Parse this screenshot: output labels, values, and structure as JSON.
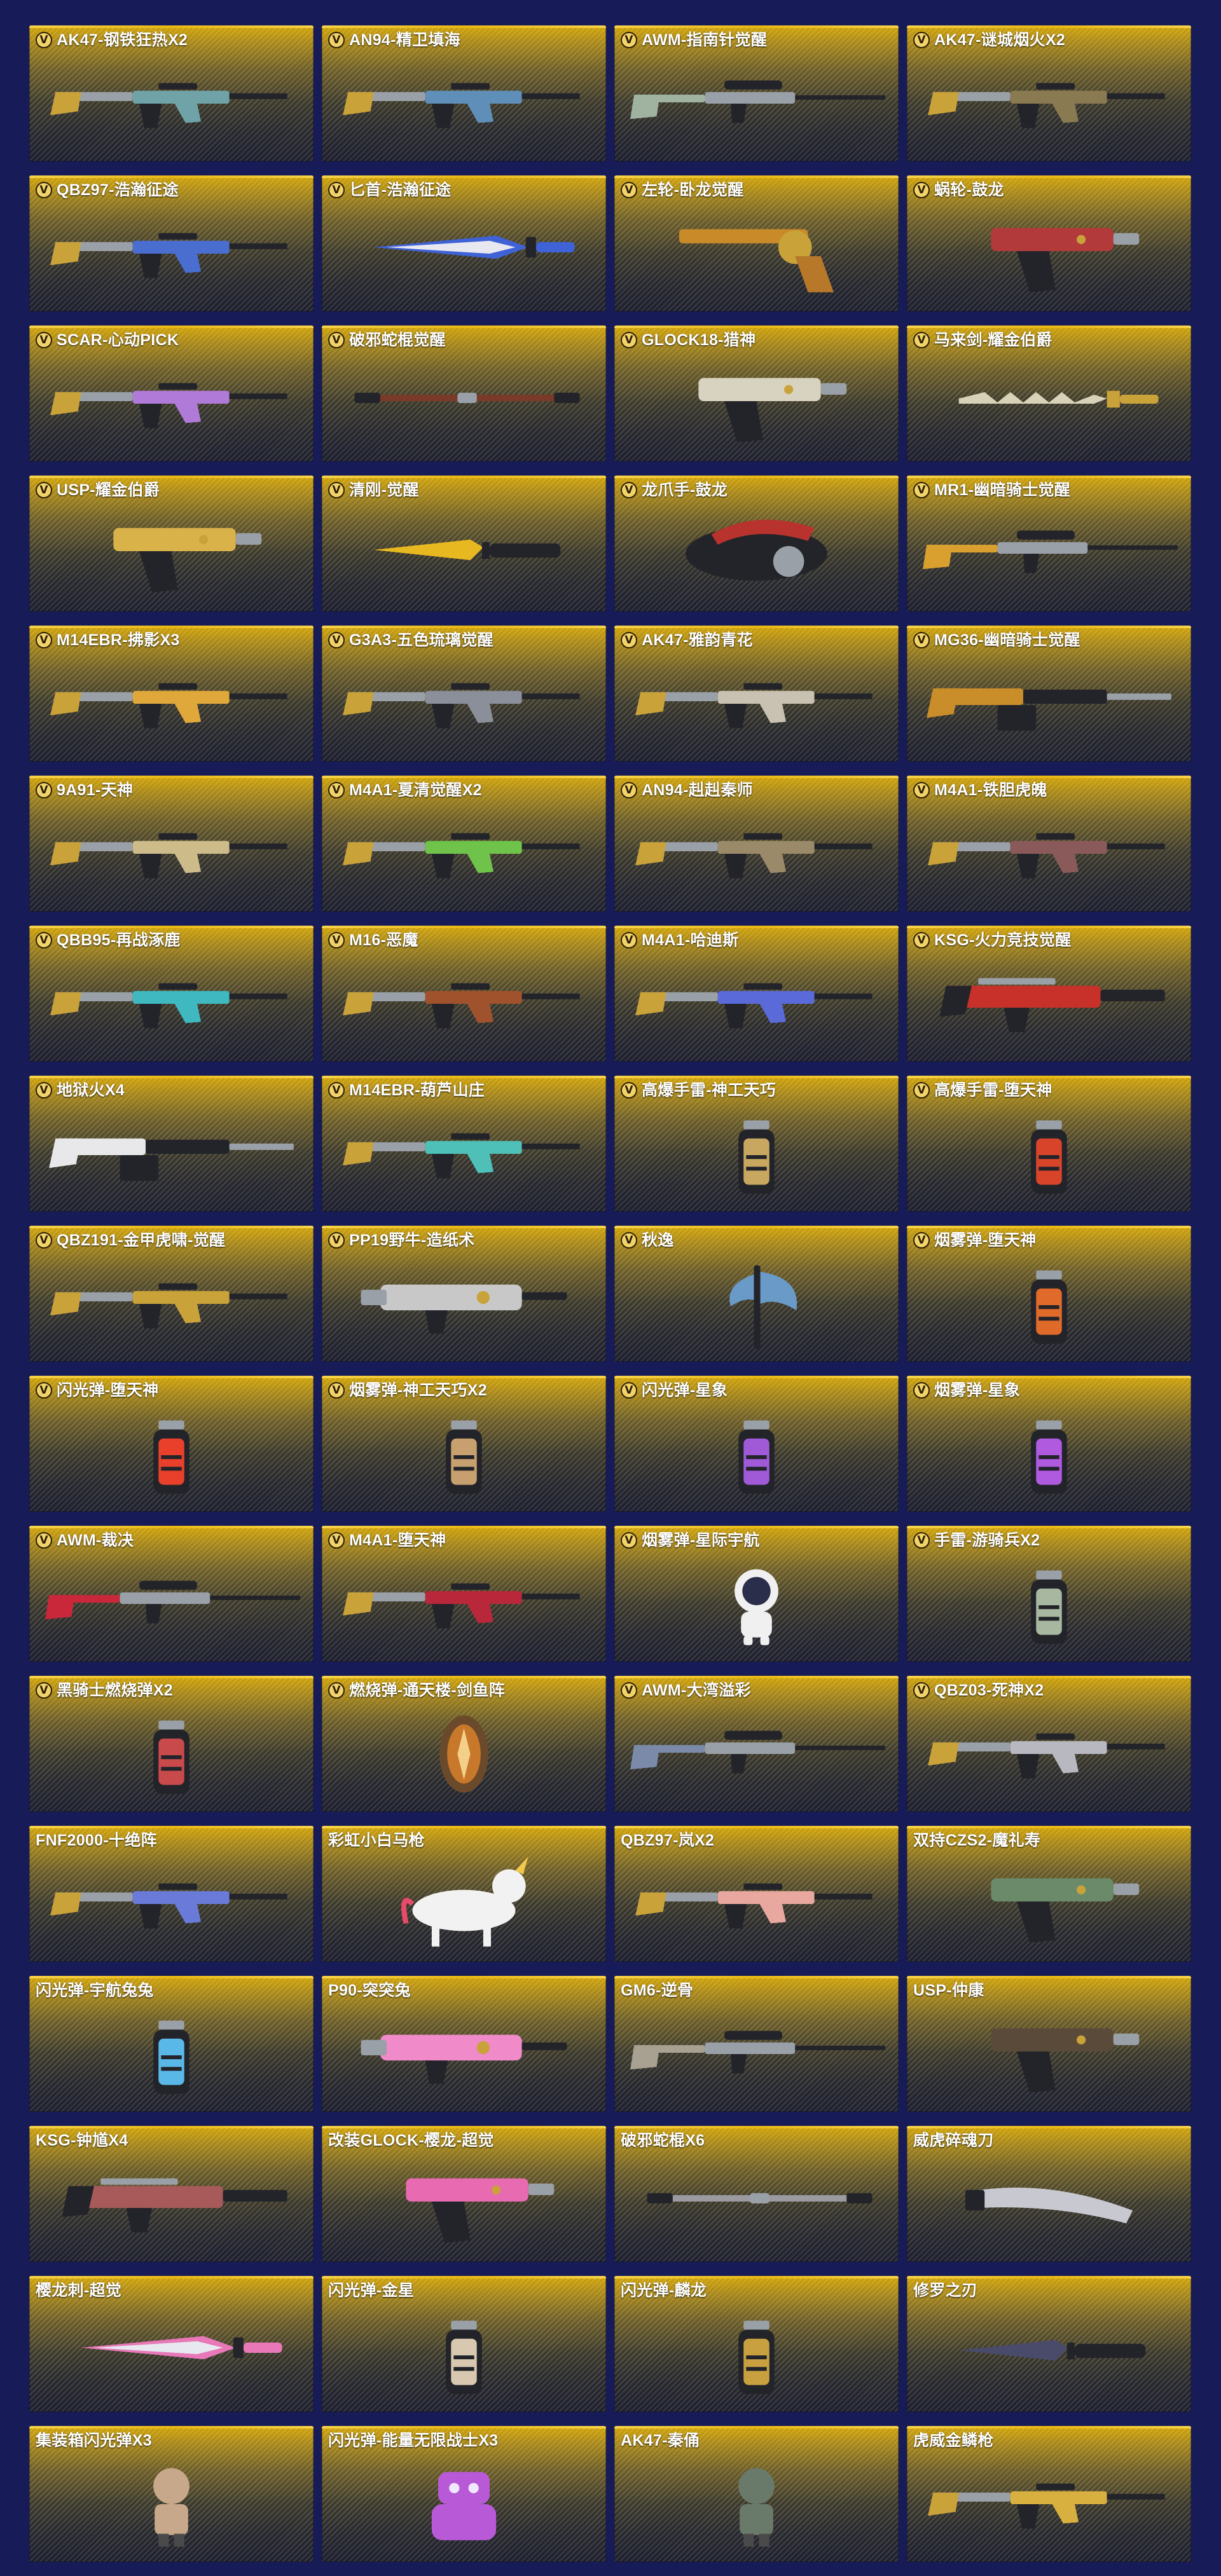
{
  "items": [
    {
      "name": "AK47-钢铁狂热X2",
      "vip": true,
      "icon": "rifle-icon",
      "accent": "#6fa3a8"
    },
    {
      "name": "AN94-精卫填海",
      "vip": true,
      "icon": "rifle-icon",
      "accent": "#5f8fb8"
    },
    {
      "name": "AWM-指南针觉醒",
      "vip": true,
      "icon": "sniper-rifle-icon",
      "accent": "#9fb3a0"
    },
    {
      "name": "AK47-谜城烟火X2",
      "vip": true,
      "icon": "rifle-icon",
      "accent": "#8a7a52"
    },
    {
      "name": "QBZ97-浩瀚征途",
      "vip": true,
      "icon": "rifle-icon",
      "accent": "#4a6ed0"
    },
    {
      "name": "匕首-浩瀚征途",
      "vip": true,
      "icon": "dagger-icon",
      "accent": "#3f62d6"
    },
    {
      "name": "左轮-卧龙觉醒",
      "vip": true,
      "icon": "revolver-icon",
      "accent": "#c98b2a"
    },
    {
      "name": "蜗轮-鼓龙",
      "vip": true,
      "icon": "pistol-icon",
      "accent": "#b33a3a"
    },
    {
      "name": "SCAR-心动PICK",
      "vip": true,
      "icon": "rifle-icon",
      "accent": "#b07ad8"
    },
    {
      "name": "破邪蛇棍觉醒",
      "vip": true,
      "icon": "staff-icon",
      "accent": "#7a3a2a"
    },
    {
      "name": "GLOCK18-猎神",
      "vip": true,
      "icon": "pistol-icon",
      "accent": "#d8d2c0"
    },
    {
      "name": "马来剑-耀金伯爵",
      "vip": true,
      "icon": "kris-sword-icon",
      "accent": "#d8d2b8"
    },
    {
      "name": "USP-耀金伯爵",
      "vip": true,
      "icon": "pistol-icon",
      "accent": "#d9b24a"
    },
    {
      "name": "清刚-觉醒",
      "vip": true,
      "icon": "knife-icon",
      "accent": "#e8b820"
    },
    {
      "name": "龙爪手-鼓龙",
      "vip": true,
      "icon": "claw-weapon-icon",
      "accent": "#b8322e"
    },
    {
      "name": "MR1-幽暗骑士觉醒",
      "vip": true,
      "icon": "sniper-rifle-icon",
      "accent": "#d9a030"
    },
    {
      "name": "M14EBR-拂影X3",
      "vip": true,
      "icon": "rifle-icon",
      "accent": "#e0a83a"
    },
    {
      "name": "G3A3-五色琉璃觉醒",
      "vip": true,
      "icon": "rifle-icon",
      "accent": "#8a8f9a"
    },
    {
      "name": "AK47-雅韵青花",
      "vip": true,
      "icon": "rifle-icon",
      "accent": "#c9c2b2"
    },
    {
      "name": "MG36-幽暗骑士觉醒",
      "vip": true,
      "icon": "machine-gun-icon",
      "accent": "#c98d2a"
    },
    {
      "name": "9A91-天神",
      "vip": true,
      "icon": "rifle-icon",
      "accent": "#cdbb8a"
    },
    {
      "name": "M4A1-夏清觉醒X2",
      "vip": true,
      "icon": "rifle-icon",
      "accent": "#6fc24a"
    },
    {
      "name": "AN94-赳赳秦师",
      "vip": true,
      "icon": "rifle-icon",
      "accent": "#9a8a6a"
    },
    {
      "name": "M4A1-铁胆虎魄",
      "vip": true,
      "icon": "rifle-icon",
      "accent": "#8a5a5a"
    },
    {
      "name": "QBB95-再战涿鹿",
      "vip": true,
      "icon": "rifle-icon",
      "accent": "#3fb8c0"
    },
    {
      "name": "M16-恶魔",
      "vip": true,
      "icon": "rifle-icon",
      "accent": "#a0522d"
    },
    {
      "name": "M4A1-哈迪斯",
      "vip": true,
      "icon": "rifle-icon",
      "accent": "#5a6ad8"
    },
    {
      "name": "KSG-火力竞技觉醒",
      "vip": true,
      "icon": "shotgun-icon",
      "accent": "#c8302a"
    },
    {
      "name": "地狱火X4",
      "vip": true,
      "icon": "machine-gun-icon",
      "accent": "#e8e8ea"
    },
    {
      "name": "M14EBR-葫芦山庄",
      "vip": true,
      "icon": "rifle-icon",
      "accent": "#4ec0b8"
    },
    {
      "name": "高爆手雷-神工天巧",
      "vip": true,
      "icon": "grenade-icon",
      "accent": "#c8a860"
    },
    {
      "name": "高爆手雷-堕天神",
      "vip": true,
      "icon": "grenade-icon",
      "accent": "#d8442a"
    },
    {
      "name": "QBZ191-金甲虎啸-觉醒",
      "vip": true,
      "icon": "rifle-icon",
      "accent": "#c9a23a"
    },
    {
      "name": "PP19野牛-造纸术",
      "vip": true,
      "icon": "smg-icon",
      "accent": "#c8c8c8"
    },
    {
      "name": "秋逸",
      "vip": true,
      "icon": "axe-icon",
      "accent": "#6a9ac8"
    },
    {
      "name": "烟雾弹-堕天神",
      "vip": true,
      "icon": "grenade-icon",
      "accent": "#e06a2a"
    },
    {
      "name": "闪光弹-堕天神",
      "vip": true,
      "icon": "grenade-icon",
      "accent": "#e8402a"
    },
    {
      "name": "烟雾弹-神工天巧X2",
      "vip": true,
      "icon": "grenade-icon",
      "accent": "#c8a070"
    },
    {
      "name": "闪光弹-星象",
      "vip": true,
      "icon": "grenade-icon",
      "accent": "#a05ad8"
    },
    {
      "name": "烟雾弹-星象",
      "vip": true,
      "icon": "grenade-icon",
      "accent": "#b05ae0"
    },
    {
      "name": "AWM-裁决",
      "vip": true,
      "icon": "sniper-rifle-icon",
      "accent": "#c8283a"
    },
    {
      "name": "M4A1-堕天神",
      "vip": true,
      "icon": "rifle-icon",
      "accent": "#b8283a"
    },
    {
      "name": "烟雾弹-星际宇航",
      "vip": true,
      "icon": "astronaut-icon",
      "accent": "#f0f0f0"
    },
    {
      "name": "手雷-游骑兵X2",
      "vip": true,
      "icon": "grenade-icon",
      "accent": "#a8b8a0"
    },
    {
      "name": "黑骑士燃烧弹X2",
      "vip": true,
      "icon": "grenade-icon",
      "accent": "#c84a4a"
    },
    {
      "name": "燃烧弹-通天楼-剑鱼阵",
      "vip": true,
      "icon": "emblem-icon",
      "accent": "#c8782a"
    },
    {
      "name": "AWM-大湾溢彩",
      "vip": true,
      "icon": "sniper-rifle-icon",
      "accent": "#7a8aa8"
    },
    {
      "name": "QBZ03-死神X2",
      "vip": true,
      "icon": "rifle-icon",
      "accent": "#b8b8c0"
    },
    {
      "name": "FNF2000-十绝阵",
      "vip": false,
      "icon": "rifle-icon",
      "accent": "#6a7ad8"
    },
    {
      "name": "彩虹小白马枪",
      "vip": false,
      "icon": "unicorn-gun-icon",
      "accent": "#f2f2f2"
    },
    {
      "name": "QBZ97-岚X2",
      "vip": false,
      "icon": "rifle-icon",
      "accent": "#e8a8a0"
    },
    {
      "name": "双持CZS2-魔礼寿",
      "vip": false,
      "icon": "pistol-icon",
      "accent": "#6a8a6a"
    },
    {
      "name": "闪光弹-宇航兔兔",
      "vip": false,
      "icon": "grenade-icon",
      "accent": "#5ab8e8"
    },
    {
      "name": "P90-突突兔",
      "vip": false,
      "icon": "smg-icon",
      "accent": "#f08ac8"
    },
    {
      "name": "GM6-逆骨",
      "vip": false,
      "icon": "sniper-rifle-icon",
      "accent": "#a8a090"
    },
    {
      "name": "USP-仲康",
      "vip": false,
      "icon": "pistol-icon",
      "accent": "#5a4a3a"
    },
    {
      "name": "KSG-钟馗X4",
      "vip": false,
      "icon": "shotgun-icon",
      "accent": "#a85a5a"
    },
    {
      "name": "改装GLOCK-樱龙-超觉",
      "vip": false,
      "icon": "pistol-icon",
      "accent": "#e86ab0"
    },
    {
      "name": "破邪蛇棍X6",
      "vip": false,
      "icon": "staff-icon",
      "accent": "#9a9aa0"
    },
    {
      "name": "威虎碎魂刀",
      "vip": false,
      "icon": "blade-icon",
      "accent": "#c8c8d0"
    },
    {
      "name": "樱龙刺-超觉",
      "vip": false,
      "icon": "dagger-icon",
      "accent": "#e878b8"
    },
    {
      "name": "闪光弹-金星",
      "vip": false,
      "icon": "grenade-icon",
      "accent": "#d8c8b0"
    },
    {
      "name": "闪光弹-麟龙",
      "vip": false,
      "icon": "grenade-icon",
      "accent": "#c8a040"
    },
    {
      "name": "修罗之刃",
      "vip": false,
      "icon": "knife-icon",
      "accent": "#4a4a6a"
    },
    {
      "name": "集装箱闪光弹X3",
      "vip": false,
      "icon": "figure-icon",
      "accent": "#c8a88a"
    },
    {
      "name": "闪光弹-能量无限战士X3",
      "vip": false,
      "icon": "robot-icon",
      "accent": "#b85ad8"
    },
    {
      "name": "AK47-秦俑",
      "vip": false,
      "icon": "figure-icon",
      "accent": "#6a7a6a"
    },
    {
      "name": "虎威金鳞枪",
      "vip": false,
      "icon": "rifle-icon",
      "accent": "#d8b040"
    }
  ],
  "colors": {
    "background": "#171b58",
    "card_gold": "#d3a50a",
    "card_dark": "#24273a"
  }
}
